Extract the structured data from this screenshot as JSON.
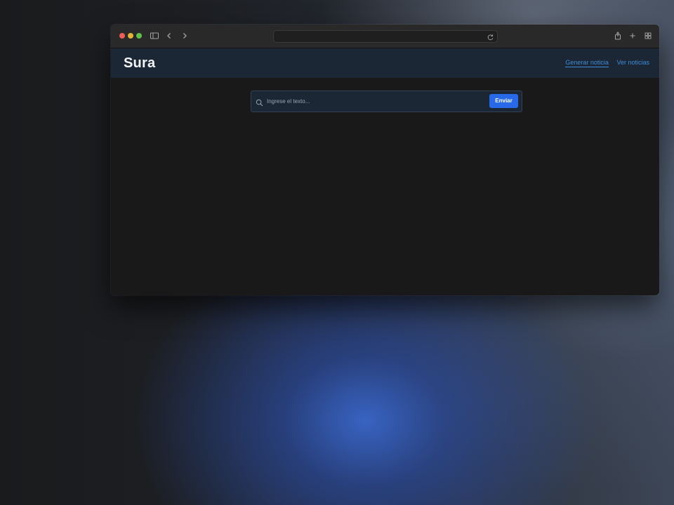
{
  "browser": {
    "address_text": ""
  },
  "app": {
    "brand": "Sura",
    "nav": [
      {
        "label": "Generar noticia",
        "active": true
      },
      {
        "label": "Ver noticias",
        "active": false
      }
    ]
  },
  "search": {
    "placeholder": "Ingrese el texto...",
    "value": "",
    "submit_label": "Enviar"
  },
  "colors": {
    "accent": "#2769e8",
    "link": "#3d8bd9",
    "header_bg": "#1c2735",
    "page_bg": "#191919"
  }
}
